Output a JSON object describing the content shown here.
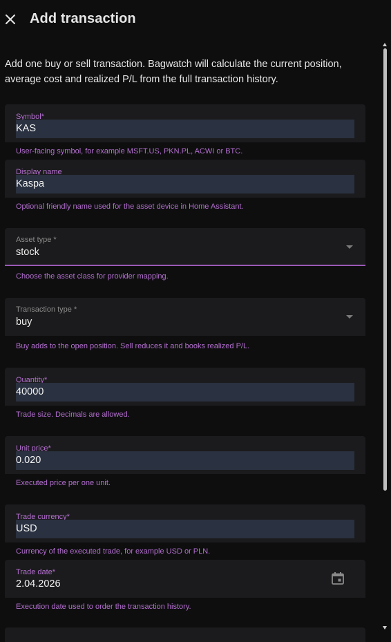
{
  "dialog": {
    "title": "Add transaction",
    "intro": "Add one buy or sell transaction. Bagwatch will calculate the current position, average cost and realized P/L from the full transaction history."
  },
  "fields": {
    "symbol": {
      "label": "Symbol*",
      "value": "KAS",
      "helper": "User-facing symbol, for example MSFT.US, PKN.PL, ACWI or BTC."
    },
    "display_name": {
      "label": "Display name",
      "value": "Kaspa",
      "helper": "Optional friendly name used for the asset device in Home Assistant."
    },
    "asset_type": {
      "label": "Asset type *",
      "value": "stock",
      "helper": "Choose the asset class for provider mapping."
    },
    "transaction_type": {
      "label": "Transaction type *",
      "value": "buy",
      "helper": "Buy adds to the open position. Sell reduces it and books realized P/L."
    },
    "quantity": {
      "label": "Quantity*",
      "value": "40000",
      "helper": "Trade size. Decimals are allowed."
    },
    "unit_price": {
      "label": "Unit price*",
      "value": "0.020",
      "helper": "Executed price per one unit."
    },
    "trade_currency": {
      "label": "Trade currency*",
      "value": "USD",
      "helper": "Currency of the executed trade, for example USD or PLN."
    },
    "trade_date": {
      "label": "Trade date*",
      "value": "2.04.2026",
      "helper": "Execution date used to order the transaction history."
    }
  },
  "colors": {
    "accent": "#9b59b6",
    "label_purple": "#b46fd0",
    "field_bg": "#1b1b1d",
    "input_bg": "#2a3140",
    "background": "#0e0e0f"
  },
  "icons": {
    "close": "close-icon",
    "calendar": "calendar-icon",
    "dropdown": "chevron-down-icon"
  }
}
